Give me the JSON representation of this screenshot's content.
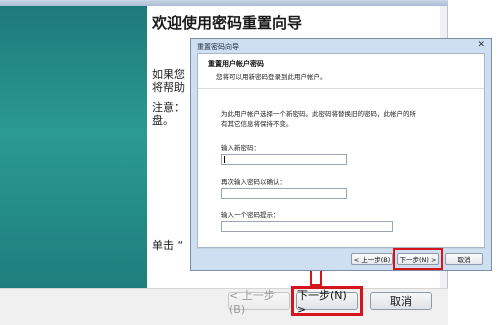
{
  "background_wizard": {
    "window_title": "重置密码向导",
    "heading": "欢迎使用密码重置向导",
    "para1_line1": "如果您",
    "para1_line2": "将帮助",
    "note_line1": "注意：",
    "note_line2": "盘。",
    "note_fragment": "…",
    "bottom_text": "单击 “",
    "buttons": {
      "back": "< 上一步(B)",
      "next": "下一步(N) >",
      "cancel": "取消"
    }
  },
  "dialog": {
    "title": "重置密码向导",
    "close": "✕",
    "header_title": "重置用户帐户密码",
    "header_subtitle": "您将可以用新密码登录到此用户帐户。",
    "desc_line1": "为此用户帐户选择一个新密码。此密码将替换旧的密码，此帐户的所",
    "desc_line2": "有其它信息将保持不变。",
    "new_password_label": "输入新密码：",
    "confirm_password_label": "再次输入密码以确认：",
    "hint_label": "输入一个密码提示：",
    "new_password_value": "",
    "confirm_password_value": "",
    "hint_value": "",
    "buttons": {
      "back": "< 上一步(B)",
      "next": "下一步(N) >",
      "cancel": "取消"
    }
  },
  "colors": {
    "highlight": "#d6141c",
    "sidebar_teal": "#1d7a7a"
  }
}
